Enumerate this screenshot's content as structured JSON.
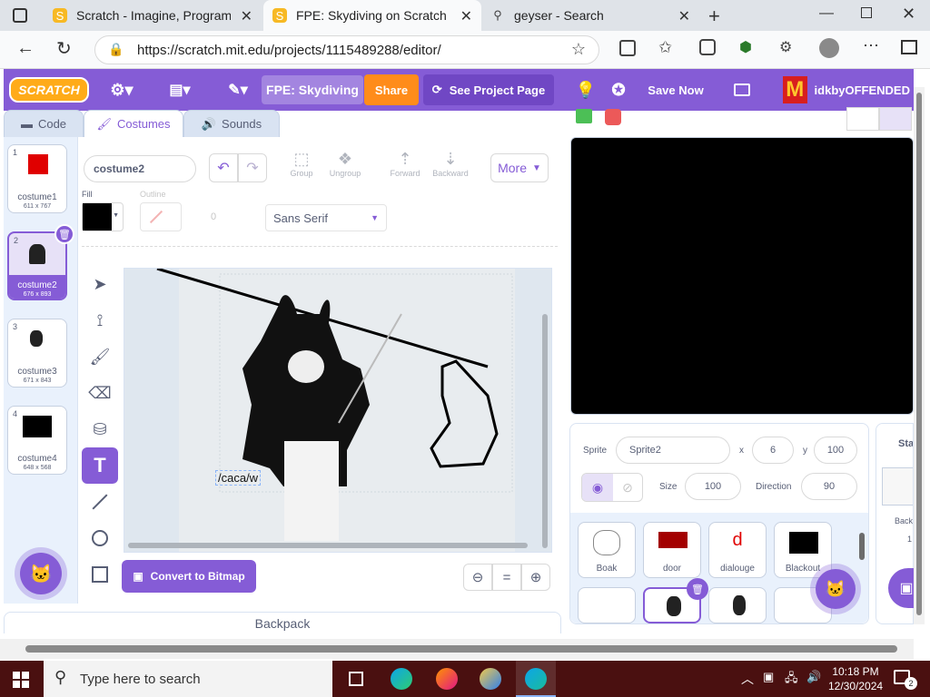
{
  "browser": {
    "tabs": [
      {
        "title": "Scratch - Imagine, Program, Share",
        "icon": "scratch-favicon"
      },
      {
        "title": "FPE: Skydiving on Scratch",
        "icon": "scratch-favicon",
        "active": true
      },
      {
        "title": "geyser - Search",
        "icon": "search-icon"
      }
    ],
    "url": "https://scratch.mit.edu/projects/1115489288/editor/"
  },
  "menubar": {
    "logo": "SCRATCH",
    "project_title": "FPE: Skydiving",
    "share_label": "Share",
    "see_project_label": "See Project Page",
    "save_label": "Save Now",
    "username": "idkbyOFFENDED",
    "accent": "#855cd6",
    "share_color": "#ff8c1a"
  },
  "editor_tabs": {
    "code": "Code",
    "costumes": "Costumes",
    "sounds": "Sounds"
  },
  "costumes": [
    {
      "num": "1",
      "name": "costume1",
      "size": "611 x 767"
    },
    {
      "num": "2",
      "name": "costume2",
      "size": "676 x 893",
      "selected": true
    },
    {
      "num": "3",
      "name": "costume3",
      "size": "671 x 843"
    },
    {
      "num": "4",
      "name": "costume4",
      "size": "648 x 568"
    }
  ],
  "paint": {
    "costume_name": "costume2",
    "group_label": "Group",
    "ungroup_label": "Ungroup",
    "forward_label": "Forward",
    "backward_label": "Backward",
    "more_label": "More",
    "fill_label": "Fill",
    "outline_label": "Outline",
    "outline_value": "0",
    "font_value": "Sans Serif",
    "text_content": "/caca/w",
    "convert_label": "Convert to Bitmap"
  },
  "backpack_label": "Backpack",
  "sprite": {
    "sprite_label": "Sprite",
    "name": "Sprite2",
    "x_label": "x",
    "x": "6",
    "y_label": "y",
    "y": "100",
    "size_label": "Size",
    "size": "100",
    "direction_label": "Direction",
    "direction": "90",
    "tiles": [
      {
        "name": "Boak"
      },
      {
        "name": "door"
      },
      {
        "name": "dialouge"
      },
      {
        "name": "Blackout"
      }
    ]
  },
  "stage_panel": {
    "title": "Stag",
    "backdrops_label": "Backd",
    "backdrops_count": "1"
  },
  "taskbar": {
    "search_placeholder": "Type here to search",
    "time": "10:18 PM",
    "date": "12/30/2024",
    "notif_count": "2"
  }
}
